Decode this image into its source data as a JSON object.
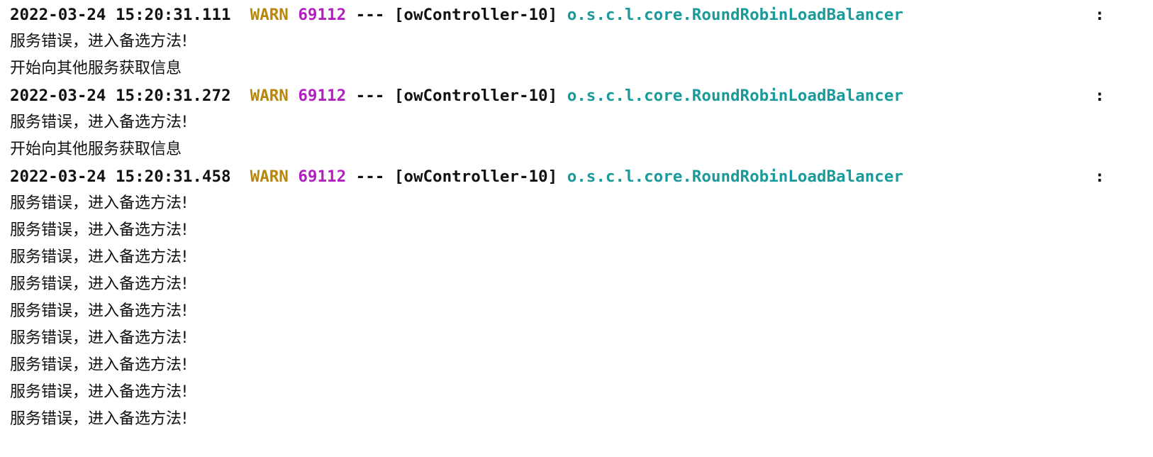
{
  "colors": {
    "level": "#b8860b",
    "pid": "#b21fbf",
    "logger": "#1a9a9a",
    "text": "#111111",
    "background": "#ffffff"
  },
  "logs": [
    {
      "timestamp": "2022-03-24 15:20:31.111",
      "level": "WARN",
      "pid": "69112",
      "sep": "---",
      "thread": "[owController-10]",
      "logger": "o.s.c.l.core.RoundRobinLoadBalancer",
      "colon": ":"
    },
    {
      "timestamp": "2022-03-24 15:20:31.272",
      "level": "WARN",
      "pid": "69112",
      "sep": "---",
      "thread": "[owController-10]",
      "logger": "o.s.c.l.core.RoundRobinLoadBalancer",
      "colon": ":"
    },
    {
      "timestamp": "2022-03-24 15:20:31.458",
      "level": "WARN",
      "pid": "69112",
      "sep": "---",
      "thread": "[owController-10]",
      "logger": "o.s.c.l.core.RoundRobinLoadBalancer",
      "colon": ":"
    }
  ],
  "messages": [
    "服务错误，进入备选方法!",
    "开始向其他服务获取信息",
    "服务错误，进入备选方法!",
    "开始向其他服务获取信息",
    "服务错误，进入备选方法!",
    "服务错误，进入备选方法!",
    "服务错误，进入备选方法!",
    "服务错误，进入备选方法!",
    "服务错误，进入备选方法!",
    "服务错误，进入备选方法!",
    "服务错误，进入备选方法!",
    "服务错误，进入备选方法!",
    "服务错误，进入备选方法!"
  ]
}
